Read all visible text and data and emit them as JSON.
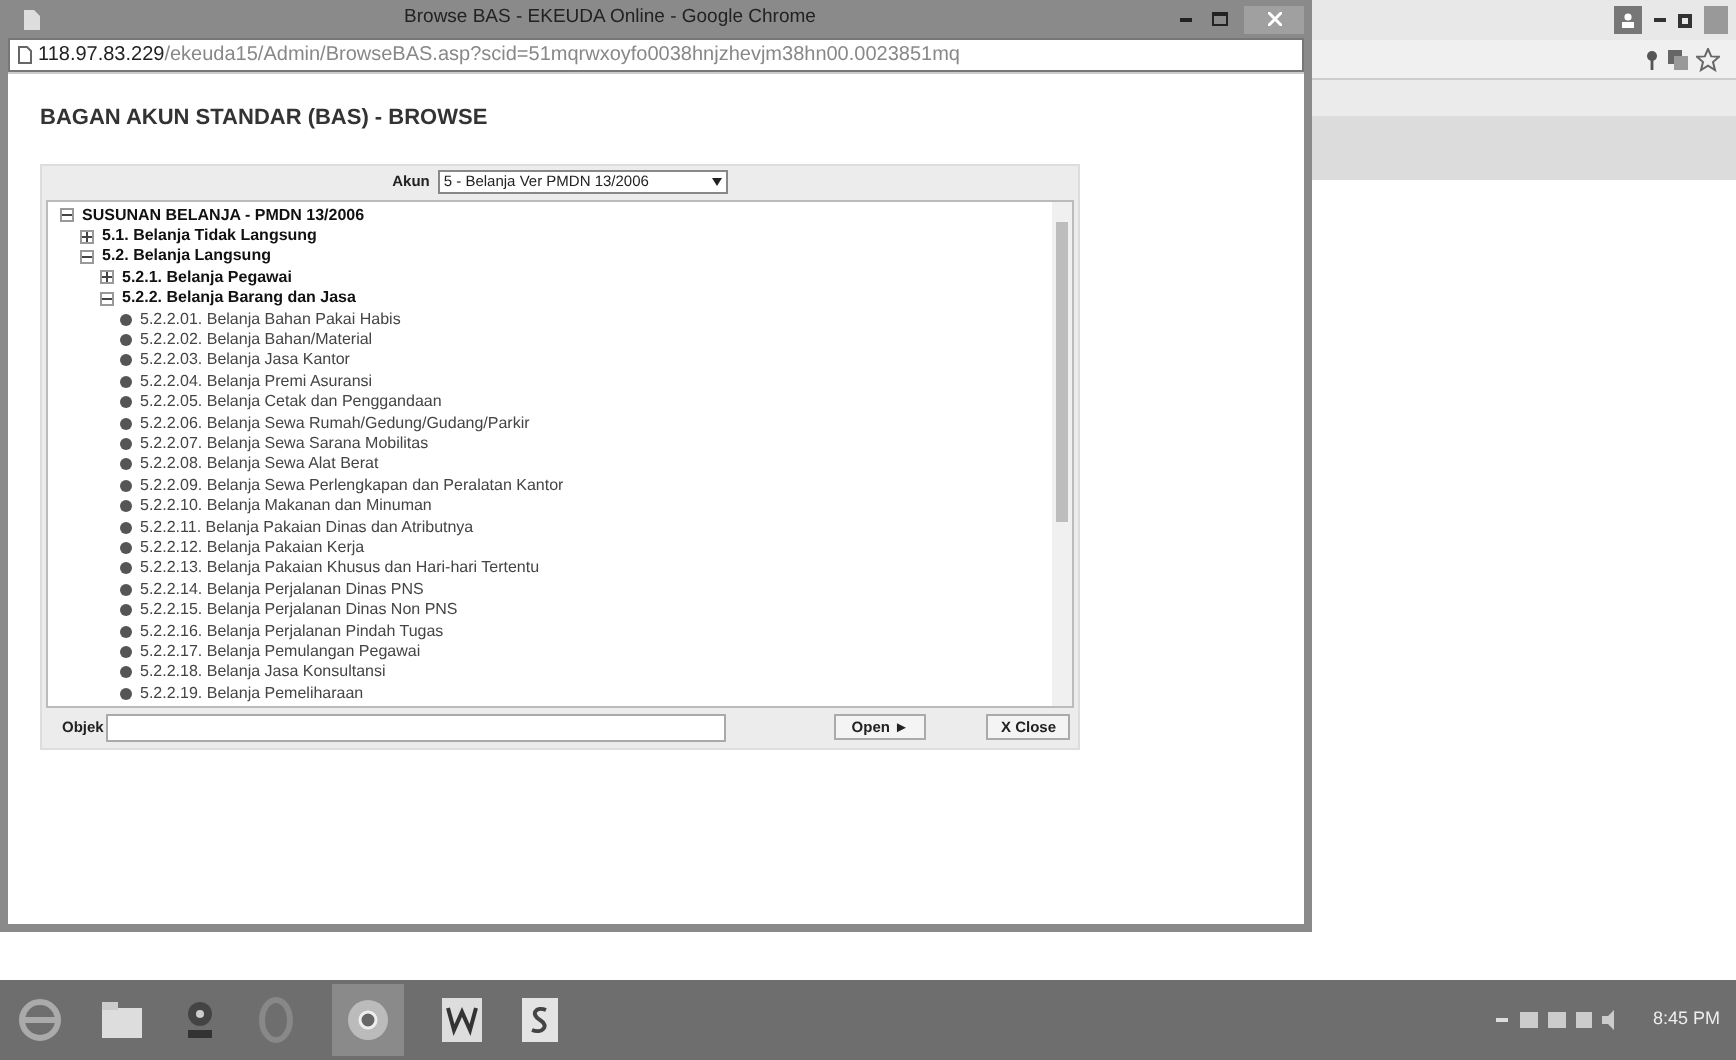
{
  "popup": {
    "title": "Browse BAS - EKEUDA Online - Google Chrome",
    "url_host": "118.97.83.229",
    "url_path": "/ekeuda15/Admin/BrowseBAS.asp?scid=51mqrwxoyfo0038hnjzhevjm38hn00.0023851mq",
    "heading": "BAGAN AKUN STANDAR (BAS) - BROWSE",
    "akun": {
      "label": "Akun",
      "value": "5 - Belanja Ver PMDN 13/2006"
    },
    "tree": [
      {
        "label": "SUSUNAN BELANJA - PMDN 13/2006",
        "expanded": true,
        "children": [
          {
            "label": "5.1. Belanja Tidak Langsung",
            "expanded": false
          },
          {
            "label": "5.2. Belanja Langsung",
            "expanded": true,
            "children": [
              {
                "label": "5.2.1. Belanja Pegawai",
                "expanded": false
              },
              {
                "label": "5.2.2. Belanja Barang dan Jasa",
                "expanded": true,
                "children": [
                  {
                    "label": "5.2.2.01. Belanja Bahan Pakai Habis"
                  },
                  {
                    "label": "5.2.2.02. Belanja Bahan/Material"
                  },
                  {
                    "label": "5.2.2.03. Belanja Jasa Kantor"
                  },
                  {
                    "label": "5.2.2.04. Belanja Premi Asuransi"
                  },
                  {
                    "label": "5.2.2.05. Belanja Cetak dan Penggandaan"
                  },
                  {
                    "label": "5.2.2.06. Belanja Sewa Rumah/Gedung/Gudang/Parkir"
                  },
                  {
                    "label": "5.2.2.07. Belanja Sewa Sarana Mobilitas"
                  },
                  {
                    "label": "5.2.2.08. Belanja Sewa Alat Berat"
                  },
                  {
                    "label": "5.2.2.09. Belanja Sewa Perlengkapan dan Peralatan Kantor"
                  },
                  {
                    "label": "5.2.2.10. Belanja Makanan dan Minuman"
                  },
                  {
                    "label": "5.2.2.11. Belanja Pakaian Dinas dan Atributnya"
                  },
                  {
                    "label": "5.2.2.12. Belanja Pakaian Kerja"
                  },
                  {
                    "label": "5.2.2.13. Belanja Pakaian Khusus dan Hari-hari Tertentu"
                  },
                  {
                    "label": "5.2.2.14. Belanja Perjalanan Dinas PNS"
                  },
                  {
                    "label": "5.2.2.15. Belanja Perjalanan Dinas Non PNS"
                  },
                  {
                    "label": "5.2.2.16. Belanja Perjalanan Pindah Tugas"
                  },
                  {
                    "label": "5.2.2.17. Belanja Pemulangan Pegawai"
                  },
                  {
                    "label": "5.2.2.18. Belanja Jasa Konsultansi"
                  },
                  {
                    "label": "5.2.2.19. Belanja Pemeliharaan"
                  }
                ]
              }
            ]
          }
        ]
      }
    ],
    "objek_label": "Objek",
    "buttons": [
      {
        "label": "Open ►"
      },
      {
        "label": "X Close"
      }
    ]
  },
  "clock": "8:45 PM"
}
